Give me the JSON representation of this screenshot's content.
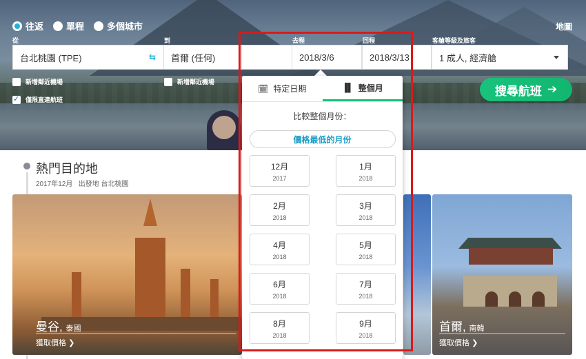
{
  "trip_types": [
    {
      "label": "往返",
      "selected": true
    },
    {
      "label": "單程",
      "selected": false
    },
    {
      "label": "多個城市",
      "selected": false
    }
  ],
  "map_link": "地圖",
  "labels": {
    "from": "從",
    "to": "到",
    "depart": "去程",
    "return": "回程",
    "cabin_travelers": "客艙等級及旅客"
  },
  "fields": {
    "from_value": "台北桃園 (TPE)",
    "to_value": "首爾 (任何)",
    "depart_value": "2018/3/6",
    "return_value": "2018/3/13",
    "cabin_value": "1 成人, 經濟艙"
  },
  "checkboxes": {
    "nearby_from": {
      "label": "新增鄰近機場",
      "checked": false
    },
    "nearby_to": {
      "label": "新增鄰近機場",
      "checked": false
    },
    "direct_only": {
      "label": "僅限直達航班",
      "checked": true
    }
  },
  "search_button": "搜尋航班",
  "popular": {
    "title": "熱門目的地",
    "month": "2017年12月",
    "origin_label": "出發地",
    "origin": "台北桃園"
  },
  "cards": [
    {
      "city": "曼谷,",
      "country": "泰國",
      "price_link": "獲取價格"
    },
    {
      "city": "首爾,",
      "country": "南韓",
      "price_link": "獲取價格"
    }
  ],
  "calendar": {
    "tab_specific": "特定日期",
    "tab_month": "整個月",
    "compare_text": "比較整個月份：",
    "cheapest_month": "價格最低的月份",
    "months": [
      {
        "m": "12月",
        "y": "2017"
      },
      {
        "m": "1月",
        "y": "2018"
      },
      {
        "m": "2月",
        "y": "2018"
      },
      {
        "m": "3月",
        "y": "2018"
      },
      {
        "m": "4月",
        "y": "2018"
      },
      {
        "m": "5月",
        "y": "2018"
      },
      {
        "m": "6月",
        "y": "2018"
      },
      {
        "m": "7月",
        "y": "2018"
      },
      {
        "m": "8月",
        "y": "2018"
      },
      {
        "m": "9月",
        "y": "2018"
      }
    ]
  },
  "colors": {
    "accent_green": "#18c27d",
    "accent_blue": "#1a9ec7",
    "highlight_red": "#d91a1a"
  }
}
